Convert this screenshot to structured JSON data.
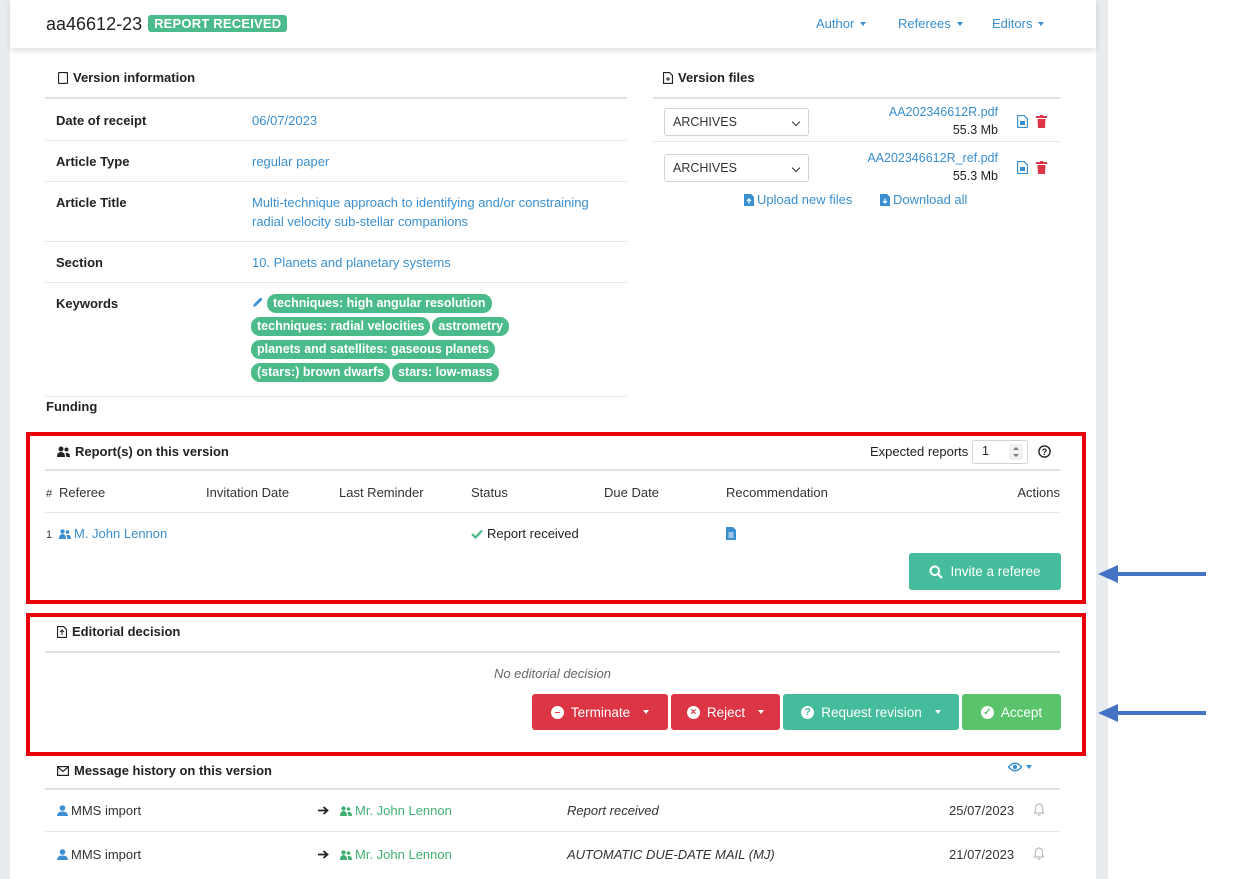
{
  "header": {
    "manuscript_id": "aa46612-23",
    "status_badge": "REPORT RECEIVED",
    "nav": {
      "author": "Author",
      "referees": "Referees",
      "editors": "Editors"
    }
  },
  "version_info": {
    "title": "Version information",
    "rows": {
      "date_label": "Date of receipt",
      "date_value": "06/07/2023",
      "type_label": "Article Type",
      "type_value": "regular paper",
      "title_label": "Article Title",
      "title_value_line1": "Multi-technique approach to identifying and/or constraining",
      "title_value_line2": "radial velocity sub-stellar companions",
      "section_label": "Section",
      "section_value": "10. Planets and planetary systems",
      "keywords_label": "Keywords"
    },
    "keywords": [
      "techniques: high angular resolution",
      "techniques: radial velocities",
      "astrometry",
      "planets and satellites: gaseous planets",
      "(stars:) brown dwarfs",
      "stars: low-mass"
    ],
    "funding_label": "Funding"
  },
  "version_files": {
    "title": "Version files",
    "files": [
      {
        "category": "ARCHIVES",
        "name": "AA202346612R.pdf",
        "size": "55.3 Mb"
      },
      {
        "category": "ARCHIVES",
        "name": "AA202346612R_ref.pdf",
        "size": "55.3 Mb"
      }
    ],
    "upload_label": "Upload new files",
    "download_label": "Download all"
  },
  "reports": {
    "title": "Report(s) on this version",
    "expected_label": "Expected reports",
    "expected_value": "1",
    "columns": {
      "num": "#",
      "referee": "Referee",
      "invitation": "Invitation Date",
      "reminder": "Last Reminder",
      "status": "Status",
      "due": "Due Date",
      "recommendation": "Recommendation",
      "actions": "Actions"
    },
    "rows": [
      {
        "num": "1",
        "referee": "M. John Lennon",
        "status": "Report received"
      }
    ],
    "invite_button": "Invite a referee"
  },
  "editorial": {
    "title": "Editorial decision",
    "empty_text": "No editorial decision",
    "buttons": {
      "terminate": "Terminate",
      "reject": "Reject",
      "revision": "Request revision",
      "accept": "Accept"
    }
  },
  "messages": {
    "title": "Message history on this version",
    "rows": [
      {
        "from": "MMS import",
        "to": "Mr. John Lennon",
        "subject": "Report received",
        "date": "25/07/2023"
      },
      {
        "from": "MMS import",
        "to": "Mr. John Lennon",
        "subject": "AUTOMATIC DUE-DATE MAIL (MJ)",
        "date": "21/07/2023"
      }
    ]
  },
  "colors": {
    "link": "#3a8fd0",
    "badge": "#4cbb8a",
    "danger": "#dc3545",
    "teal": "#45bc9b",
    "success": "#59c46b",
    "highlight": "#e8000b",
    "arrow": "#4472c4"
  }
}
